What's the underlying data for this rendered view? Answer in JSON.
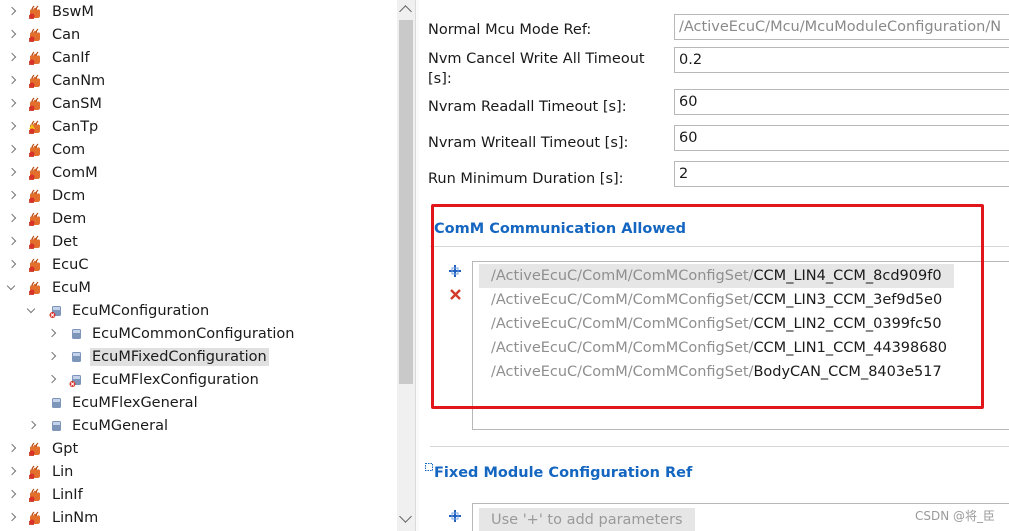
{
  "tree": {
    "items": [
      {
        "label": "BswM",
        "state": "closed",
        "icon": "module-icon"
      },
      {
        "label": "Can",
        "state": "closed",
        "icon": "module-icon"
      },
      {
        "label": "CanIf",
        "state": "closed",
        "icon": "module-icon"
      },
      {
        "label": "CanNm",
        "state": "closed",
        "icon": "module-icon"
      },
      {
        "label": "CanSM",
        "state": "closed",
        "icon": "module-icon"
      },
      {
        "label": "CanTp",
        "state": "closed",
        "icon": "module-warning-icon"
      },
      {
        "label": "Com",
        "state": "closed",
        "icon": "module-icon"
      },
      {
        "label": "ComM",
        "state": "closed",
        "icon": "module-icon"
      },
      {
        "label": "Dcm",
        "state": "closed",
        "icon": "module-icon"
      },
      {
        "label": "Dem",
        "state": "closed",
        "icon": "module-icon"
      },
      {
        "label": "Det",
        "state": "closed",
        "icon": "module-icon"
      },
      {
        "label": "EcuC",
        "state": "closed",
        "icon": "module-icon"
      },
      {
        "label": "EcuM",
        "state": "open",
        "icon": "module-icon"
      },
      {
        "label": "EcuMConfiguration",
        "state": "open",
        "icon": "container-error-icon"
      },
      {
        "label": "EcuMCommonConfiguration",
        "state": "closed",
        "icon": "container-icon"
      },
      {
        "label": "EcuMFixedConfiguration",
        "state": "closed",
        "icon": "container-icon"
      },
      {
        "label": "EcuMFlexConfiguration",
        "state": "closed",
        "icon": "container-error-icon"
      },
      {
        "label": "EcuMFlexGeneral",
        "state": "none",
        "icon": "container-icon"
      },
      {
        "label": "EcuMGeneral",
        "state": "closed",
        "icon": "container-icon"
      },
      {
        "label": "Gpt",
        "state": "closed",
        "icon": "module-icon"
      },
      {
        "label": "Lin",
        "state": "closed",
        "icon": "module-icon"
      },
      {
        "label": "LinIf",
        "state": "closed",
        "icon": "module-icon"
      },
      {
        "label": "LinNm",
        "state": "closed",
        "icon": "module-icon"
      }
    ],
    "selected": "EcuMFixedConfiguration"
  },
  "form": {
    "fields": [
      {
        "label": "Normal Mcu Mode Ref:",
        "value": "/ActiveEcuC/Mcu/McuModuleConfiguration/N",
        "readonly": true
      },
      {
        "label_line1": "Nvm Cancel Write All Timeout",
        "label_line2": "[s]:",
        "value": "0.2"
      },
      {
        "label": "Nvram Readall Timeout [s]:",
        "value": "60"
      },
      {
        "label": "Nvram Writeall Timeout [s]:",
        "value": "60"
      },
      {
        "label": "Run Minimum Duration [s]:",
        "value": "2"
      }
    ],
    "comm_section": {
      "title": "ComM Communication Allowed",
      "items": [
        {
          "path": "/ActiveEcuC/ComM/ComMConfigSet/",
          "name": "CCM_LIN4_CCM_8cd909f0"
        },
        {
          "path": "/ActiveEcuC/ComM/ComMConfigSet/",
          "name": "CCM_LIN3_CCM_3ef9d5e0"
        },
        {
          "path": "/ActiveEcuC/ComM/ComMConfigSet/",
          "name": "CCM_LIN2_CCM_0399fc50"
        },
        {
          "path": "/ActiveEcuC/ComM/ComMConfigSet/",
          "name": "CCM_LIN1_CCM_44398680"
        },
        {
          "path": "/ActiveEcuC/ComM/ComMConfigSet/",
          "name": "BodyCAN_CCM_8403e517"
        }
      ]
    },
    "fixed_section": {
      "title": "Fixed Module Configuration Ref",
      "empty_hint": "Use '+' to add parameters"
    }
  },
  "watermark": "CSDN @将_臣",
  "colors": {
    "accent": "#1466c0",
    "highlight_box": "#e0161b",
    "add_button": "#1f5fbf",
    "remove_button": "#d23b2b"
  }
}
